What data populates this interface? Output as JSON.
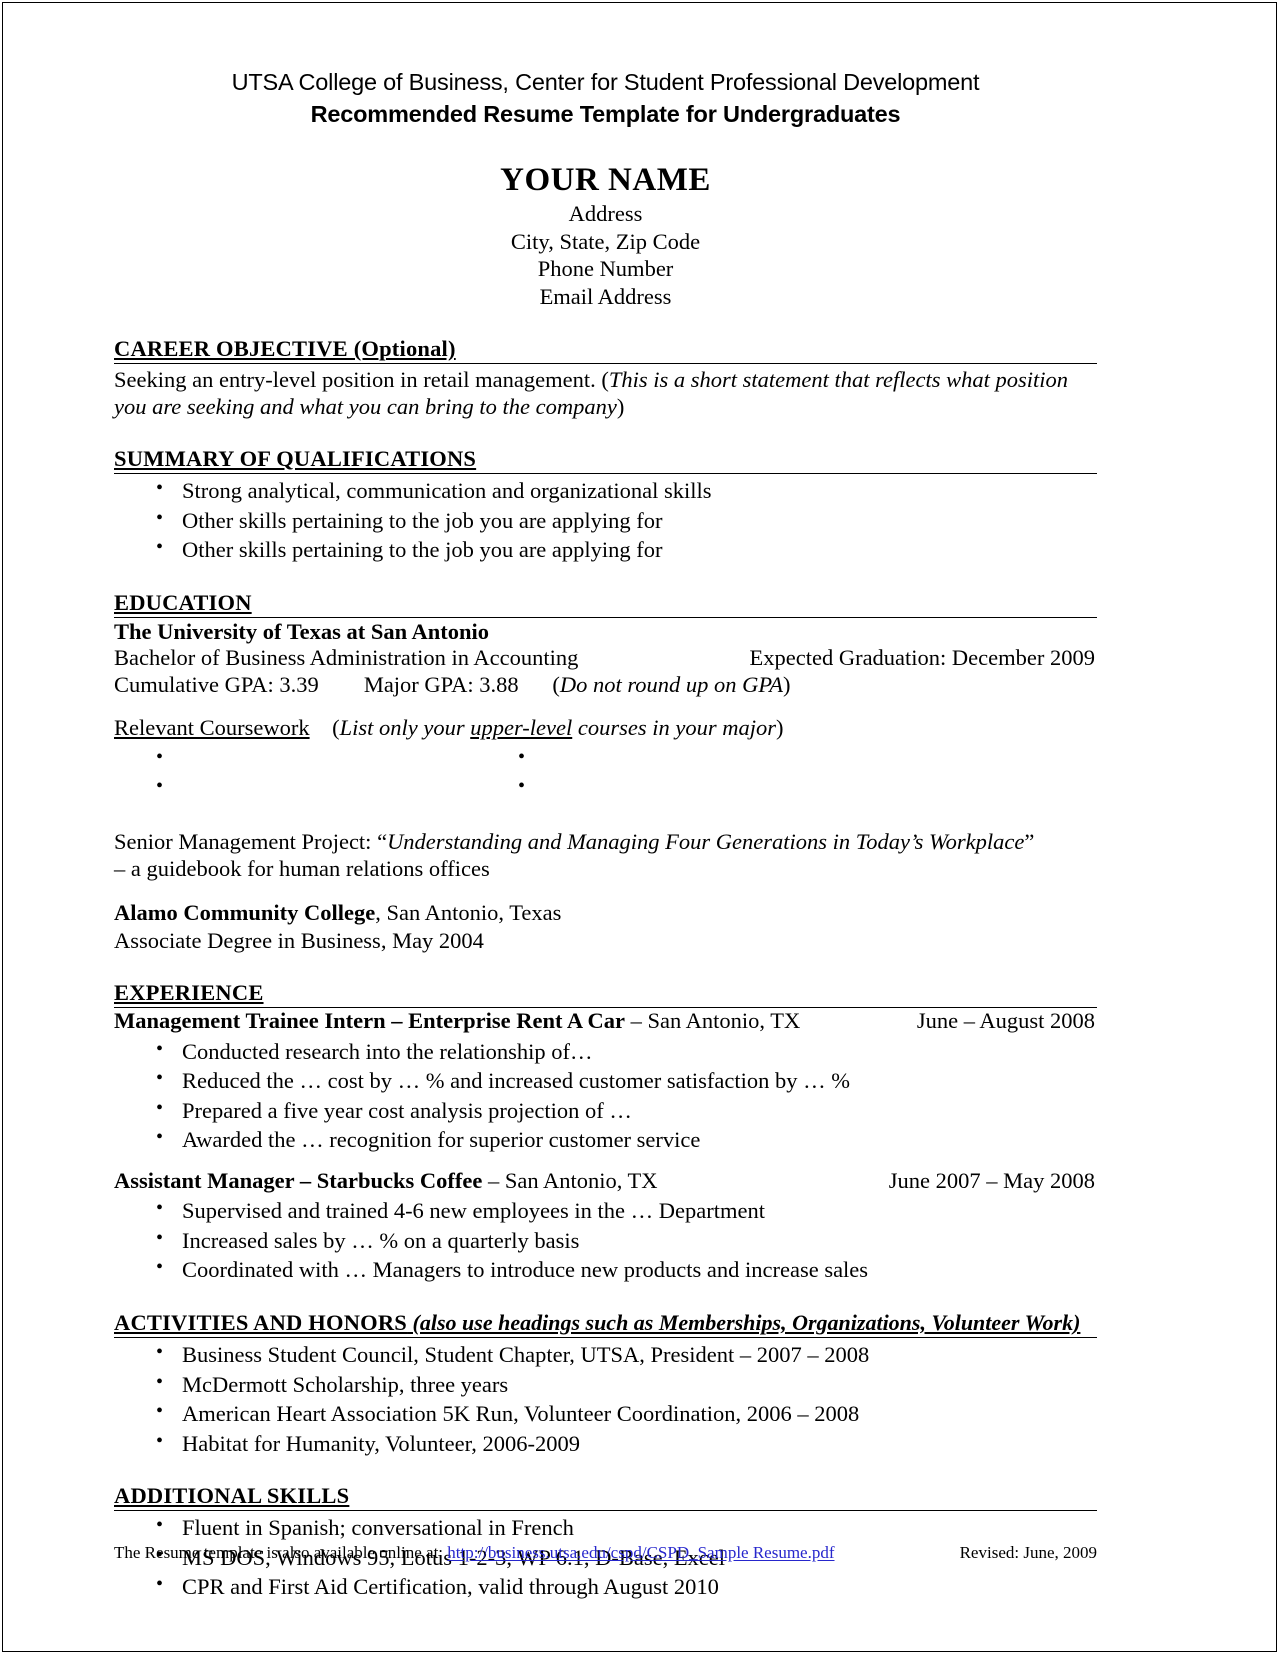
{
  "document": {
    "header": {
      "org_line": "UTSA College of Business, Center for Student Professional Development",
      "title_line": "Recommended Resume Template for Undergraduates"
    },
    "name_block": {
      "name": "YOUR NAME",
      "address": "Address",
      "city_state_zip": "City, State, Zip Code",
      "phone": "Phone Number",
      "email": "Email Address"
    },
    "career_objective": {
      "heading": "CAREER OBJECTIVE (Optional)",
      "text_plain": "Seeking an entry-level position in retail management. (",
      "text_italic": "This is a short statement that reflects what position you are seeking and what you can bring to the company",
      "text_close": ")"
    },
    "summary": {
      "heading": "SUMMARY OF QUALIFICATIONS",
      "bullets": [
        "Strong analytical, communication and organizational skills",
        "Other skills pertaining to the job you are applying for",
        "Other skills pertaining to the job you are applying for"
      ]
    },
    "education": {
      "heading": "EDUCATION",
      "school": "The University of Texas at San Antonio",
      "degree": "Bachelor of Business Administration in Accounting",
      "graduation": "Expected Graduation: December 2009",
      "cumulative_gpa": "Cumulative GPA: 3.39",
      "major_gpa": "Major GPA: 3.88",
      "gpa_note_open": "(",
      "gpa_note_italic": "Do not round up on GPA",
      "gpa_note_close": ")",
      "coursework_label": "Relevant Coursework",
      "coursework_note_open": "(",
      "coursework_note_1": "List only your ",
      "coursework_note_underline": "upper-level",
      "coursework_note_2": " courses in your major",
      "coursework_note_close": ")",
      "coursework_left": [
        "",
        ""
      ],
      "coursework_right": [
        "",
        ""
      ],
      "project_label": "Senior Management Project: ",
      "project_quote_open": "“",
      "project_title": "Understanding and Managing Four Generations in Today’s Workplace",
      "project_quote_close": "”",
      "project_sub": "– a guidebook for human relations offices",
      "college2_bold": "Alamo Community College",
      "college2_rest": ", San Antonio, Texas",
      "college2_degree": "Associate Degree in Business, May 2004"
    },
    "experience": {
      "heading": "EXPERIENCE",
      "jobs": [
        {
          "title_bold": "Management Trainee Intern – Enterprise Rent A Car",
          "title_rest": " – San Antonio, TX",
          "dates": "June – August 2008",
          "bullets": [
            "Conducted research into the relationship of…",
            "Reduced the … cost by … % and increased customer satisfaction by … %",
            "Prepared a five year cost analysis projection of …",
            "Awarded the … recognition for superior customer service"
          ]
        },
        {
          "title_bold": "Assistant Manager – Starbucks Coffee",
          "title_rest": " – San Antonio, TX",
          "dates": "June 2007 – May 2008",
          "bullets": [
            "Supervised and trained 4-6 new employees in the … Department",
            "Increased sales by … % on a quarterly basis",
            "Coordinated with … Managers to introduce new products and increase sales"
          ]
        }
      ]
    },
    "activities": {
      "heading": "ACTIVITIES AND HONORS",
      "heading_note": " (also use headings such as Memberships, Organizations, Volunteer Work)",
      "bullets": [
        "Business Student Council, Student Chapter, UTSA, President – 2007 – 2008",
        "McDermott Scholarship, three years",
        "American Heart Association 5K Run, Volunteer Coordination, 2006 – 2008",
        "Habitat for Humanity, Volunteer, 2006-2009"
      ]
    },
    "additional_skills": {
      "heading": "ADDITIONAL SKILLS",
      "bullets": [
        "Fluent in Spanish; conversational in French",
        "MS DOS, Windows 95, Lotus 1-2-3, WP 6.1, D-Base, Excel",
        "CPR and First Aid Certification, valid through August 2010"
      ]
    },
    "footer": {
      "note": "The Resume template is also available online at: ",
      "link_text": "http://business.utsa.edu/cspd/CSPD_Sample Resume.pdf",
      "revised": "Revised: June, 2009",
      "link_color": "#2626CC"
    }
  }
}
